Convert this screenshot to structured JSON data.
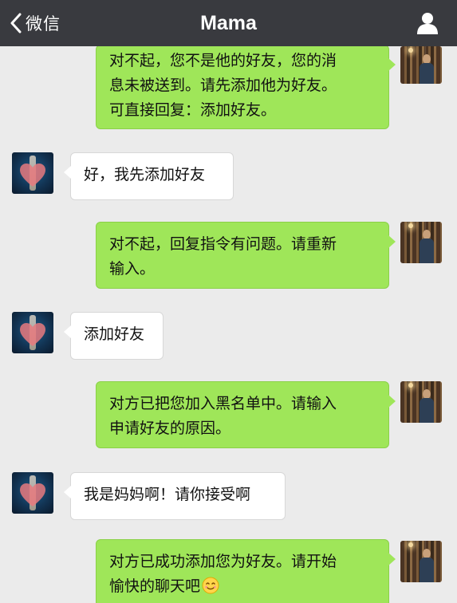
{
  "header": {
    "back_label": "微信",
    "title": "Mama"
  },
  "messages": [
    {
      "side": "me",
      "lines": [
        "对不起，您不是他的好友，您的消",
        "息未被送到。请先添加他为好友。",
        "可直接回复：添加好友。"
      ]
    },
    {
      "side": "them",
      "lines": [
        "好，我先添加好友"
      ]
    },
    {
      "side": "me",
      "lines": [
        "对不起，回复指令有问题。请重新",
        "输入。"
      ]
    },
    {
      "side": "them",
      "lines": [
        "添加好友"
      ]
    },
    {
      "side": "me",
      "lines": [
        "对方已把您加入黑名单中。请输入",
        "申请好友的原因。"
      ]
    },
    {
      "side": "them",
      "lines": [
        "我是妈妈啊！请你接受啊"
      ]
    },
    {
      "side": "me",
      "lines": [
        "对方已成功添加您为好友。请开始",
        "愉快的聊天吧"
      ],
      "emoji": "smile-emoji"
    }
  ],
  "colors": {
    "header_bg": "#393a3f",
    "chat_bg": "#ebebeb",
    "my_bubble": "#9fe659",
    "their_bubble": "#ffffff"
  },
  "icons": [
    "chevron-left-icon",
    "profile-icon",
    "smile-emoji"
  ]
}
